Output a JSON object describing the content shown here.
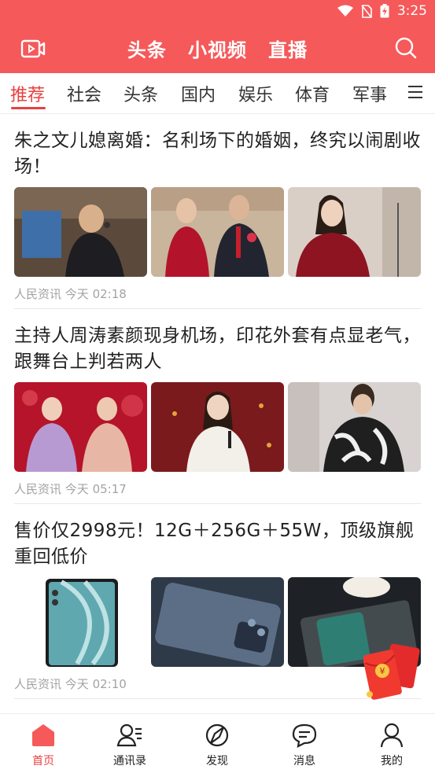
{
  "status": {
    "time": "3:25"
  },
  "colors": {
    "brand": "#f5595a",
    "accent": "#e8413f",
    "meta": "#a3a3a3"
  },
  "topnav": {
    "left_icon": "video-icon",
    "tabs": [
      "头条",
      "小视频",
      "直播"
    ],
    "right_icon": "search-icon"
  },
  "channels": {
    "items": [
      "推荐",
      "社会",
      "头条",
      "国内",
      "娱乐",
      "体育",
      "军事"
    ],
    "selected": "推荐",
    "menu_icon": "menu-icon"
  },
  "articles": [
    {
      "title": "朱之文儿媳离婚：名利场下的婚姻，终究以闹剧收场！",
      "source": "人民资讯",
      "time": "今天 02:18"
    },
    {
      "title": "主持人周涛素颜现身机场，印花外套有点显老气，跟舞台上判若两人",
      "source": "人民资讯",
      "time": "今天 05:17"
    },
    {
      "title": "售价仅2998元！12G＋256G＋55W，顶级旗舰重回低价",
      "source": "人民资讯",
      "time": "今天 02:10"
    }
  ],
  "bottom_tabs": [
    {
      "label": "首页",
      "icon": "home-icon"
    },
    {
      "label": "通讯录",
      "icon": "contacts-icon"
    },
    {
      "label": "发现",
      "icon": "discover-icon"
    },
    {
      "label": "消息",
      "icon": "message-icon"
    },
    {
      "label": "我的",
      "icon": "profile-icon"
    }
  ]
}
